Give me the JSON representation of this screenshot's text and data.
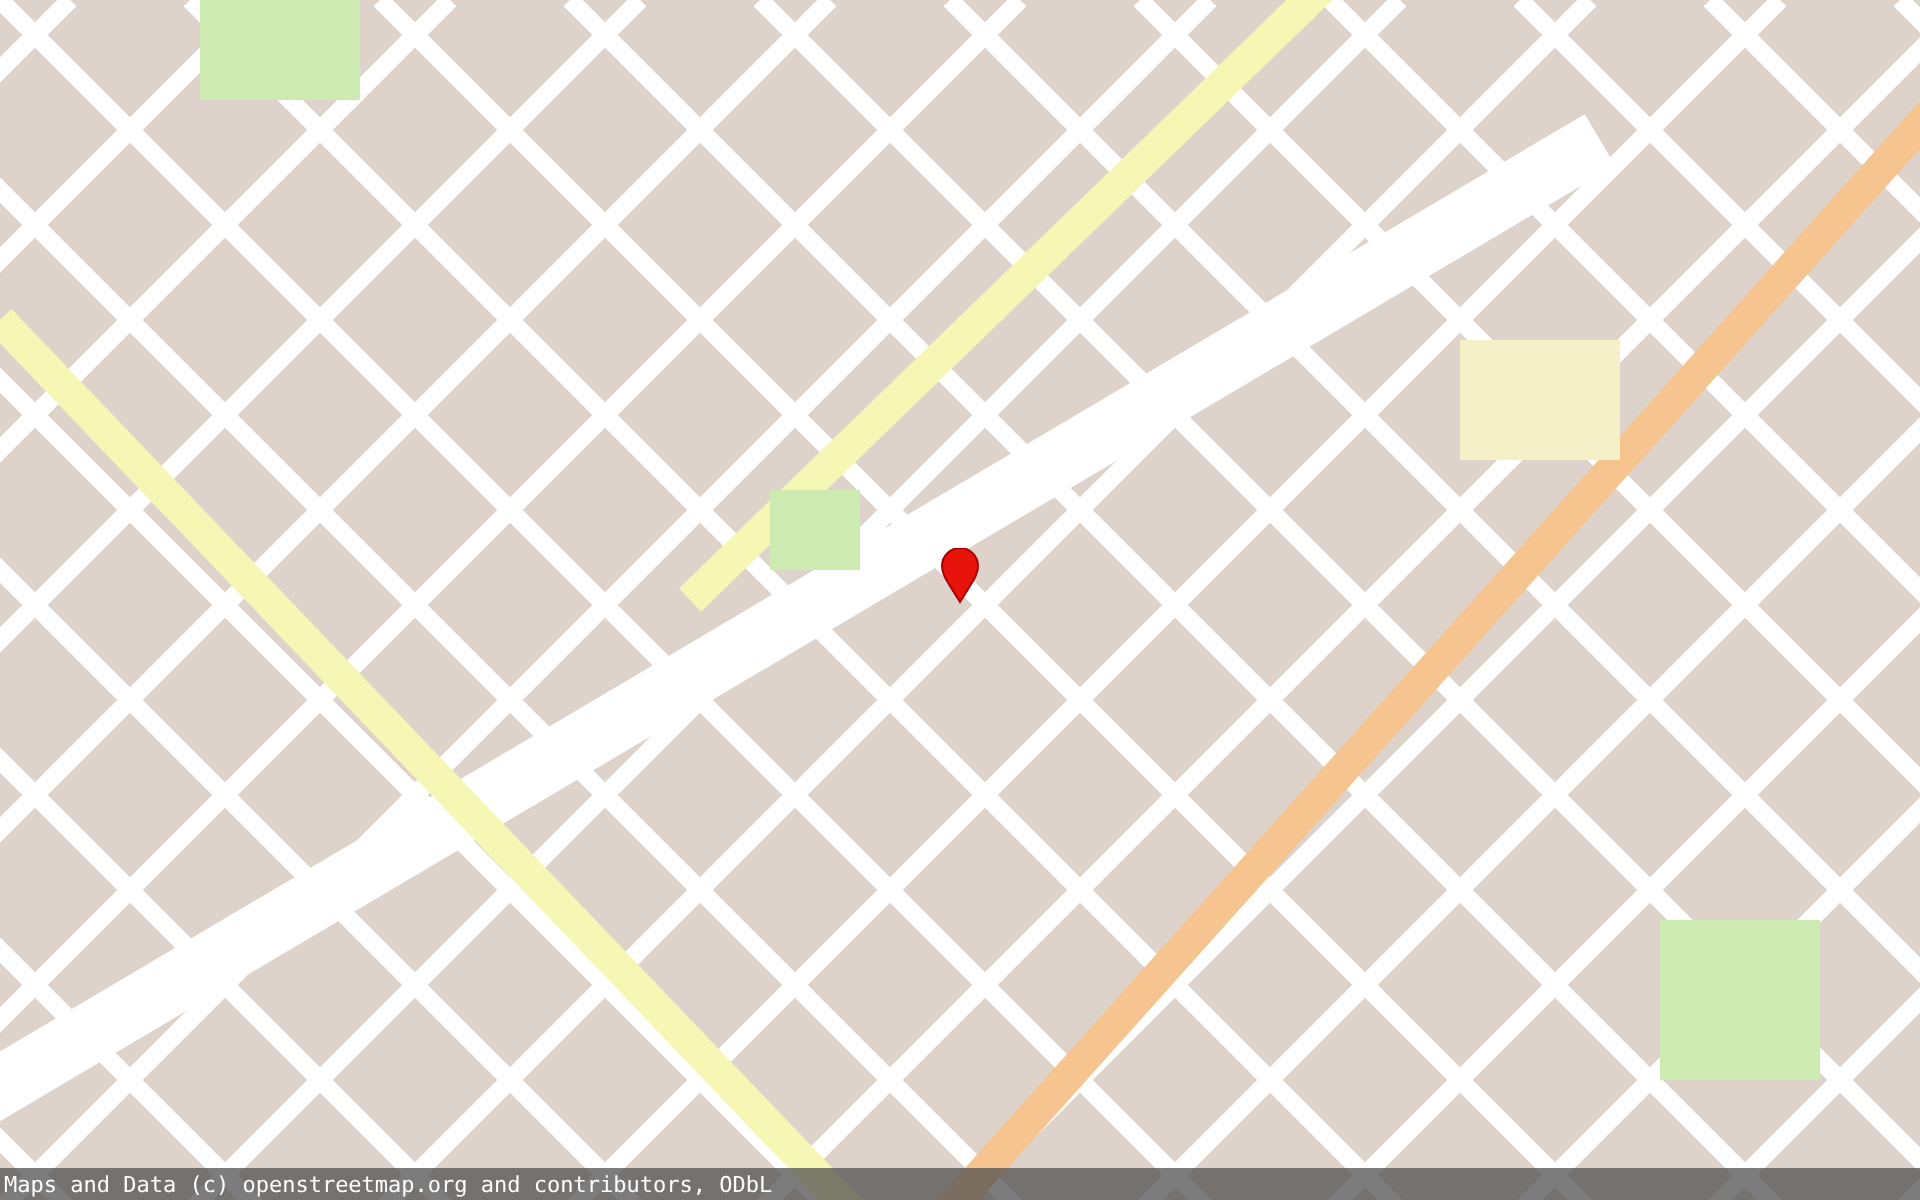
{
  "attribution": "Maps and Data (c) openstreetmap.org and contributors, ODbL"
}
